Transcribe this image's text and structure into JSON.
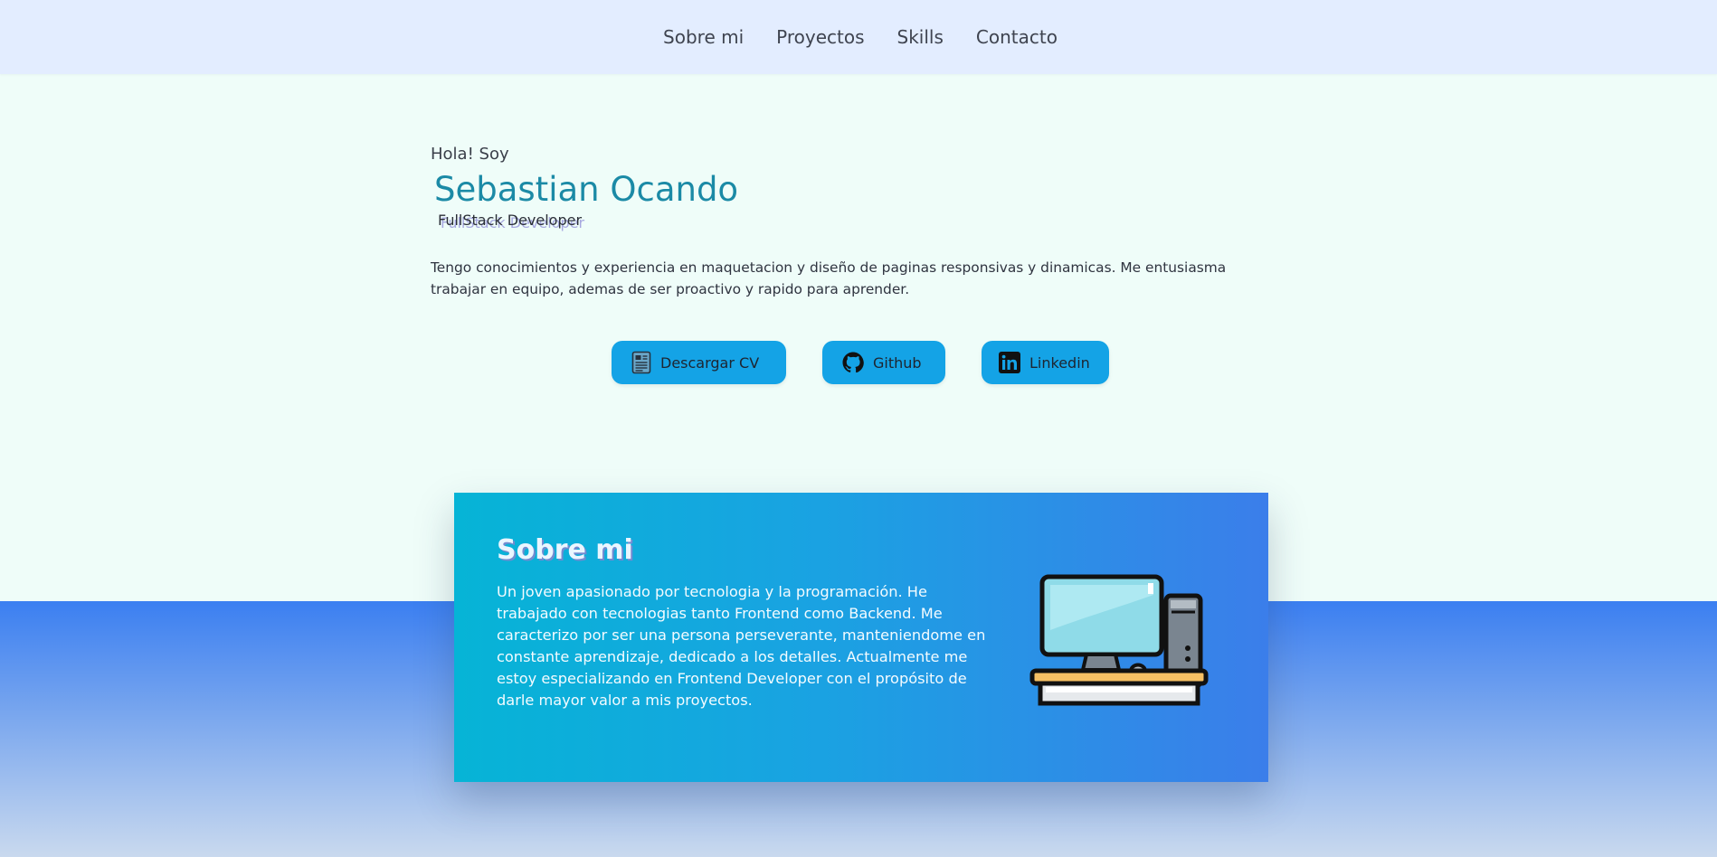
{
  "nav": {
    "items": [
      {
        "label": "Sobre mi"
      },
      {
        "label": "Proyectos"
      },
      {
        "label": "Skills"
      },
      {
        "label": "Contacto"
      }
    ]
  },
  "hero": {
    "greeting": "Hola! Soy",
    "name": "Sebastian Ocando",
    "role": "FullStack Developer",
    "description": "Tengo conocimientos y experiencia en maquetacion y diseño de paginas responsivas y dinamicas. Me entusiasma trabajar en equipo, ademas de ser proactivo y rapido para aprender."
  },
  "actions": {
    "cv_label": "Descargar CV",
    "github_label": "Github",
    "linkedin_label": "Linkedin",
    "icons": [
      "document-icon",
      "github-icon",
      "linkedin-icon"
    ]
  },
  "about": {
    "title": "Sobre mi",
    "text": "Un joven apasionado por tecnologia y la programación. He trabajado con tecnologias tanto Frontend como Backend. Me caracterizo por ser una persona perseverante, manteniendome en constante aprendizaje, dedicado a los detalles. Actualmente me estoy especializando en Frontend Developer con el propósito de darle mayor valor a mis proyectos.",
    "illustration": "desktop-computer-icon"
  },
  "colors": {
    "nav_bg": "#e3edff",
    "page_bg": "#effdf9",
    "name": "#1b8aa6",
    "button_bg": "#14a3e6",
    "card_start": "#06b4d6",
    "card_end": "#3b7eea"
  }
}
